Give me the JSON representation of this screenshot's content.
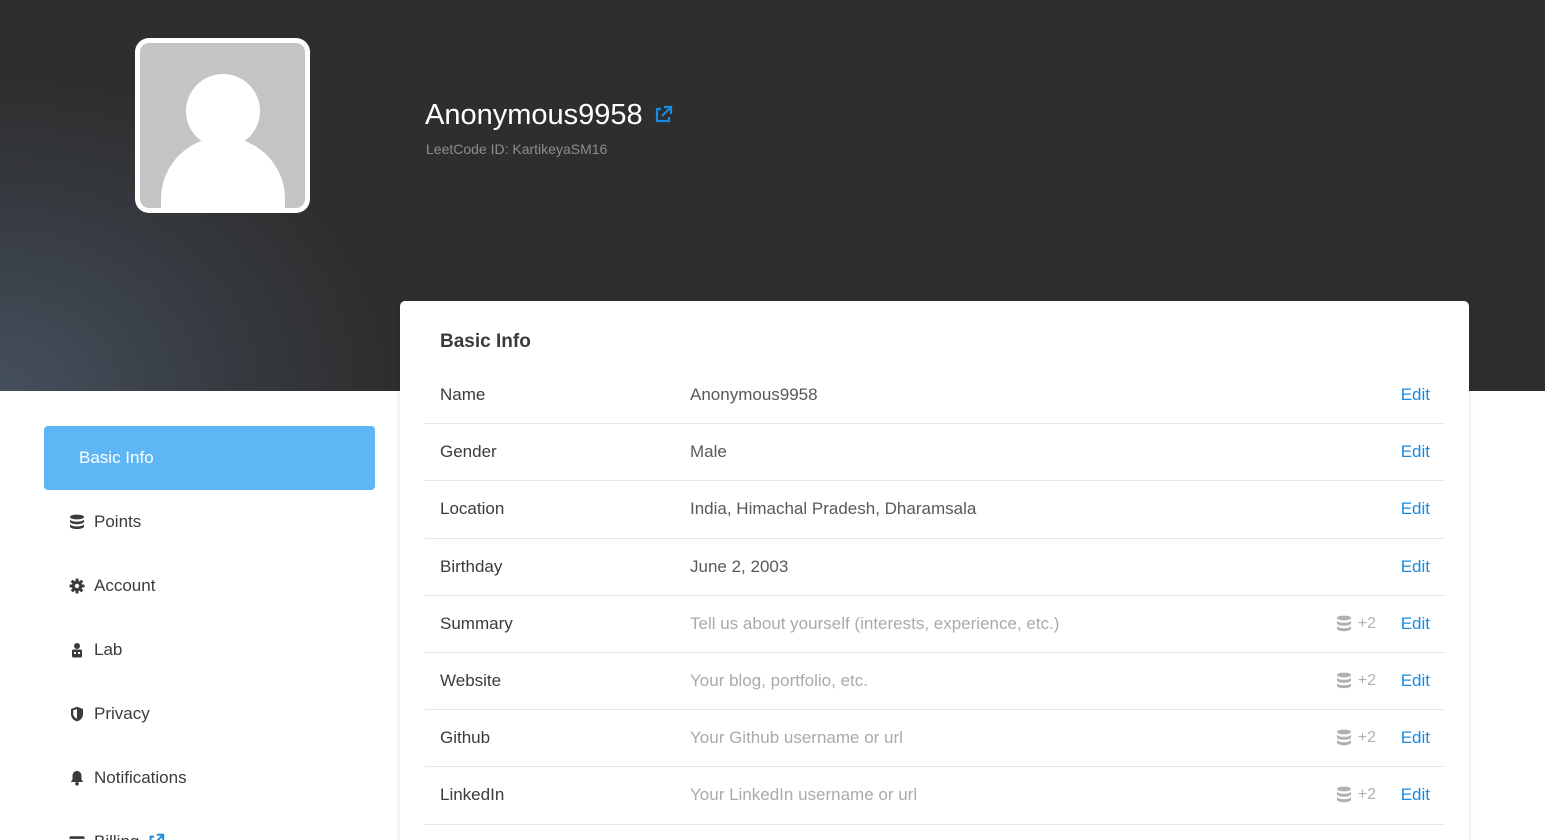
{
  "profile": {
    "username": "Anonymous9958",
    "leetcode_id": "LeetCode ID: KartikeyaSM16"
  },
  "sidebar": {
    "items": [
      {
        "label": "Basic Info",
        "icon": "none",
        "active": true
      },
      {
        "label": "Points",
        "icon": "database-icon"
      },
      {
        "label": "Account",
        "icon": "gear-icon"
      },
      {
        "label": "Lab",
        "icon": "lab-icon"
      },
      {
        "label": "Privacy",
        "icon": "shield-icon"
      },
      {
        "label": "Notifications",
        "icon": "bell-icon"
      },
      {
        "label": "Billing",
        "icon": "credit-card-icon"
      }
    ]
  },
  "basic_info": {
    "title": "Basic Info",
    "edit_label": "Edit",
    "rows": [
      {
        "label": "Name",
        "value": "Anonymous9958"
      },
      {
        "label": "Gender",
        "value": "Male"
      },
      {
        "label": "Location",
        "value": "India, Himachal Pradesh, Dharamsala"
      },
      {
        "label": "Birthday",
        "value": "June 2, 2003"
      },
      {
        "label": "Summary",
        "placeholder": "Tell us about yourself (interests, experience, etc.)",
        "points": "+2"
      },
      {
        "label": "Website",
        "placeholder": "Your blog, portfolio, etc.",
        "points": "+2"
      },
      {
        "label": "Github",
        "placeholder": "Your Github username or url",
        "points": "+2"
      },
      {
        "label": "LinkedIn",
        "placeholder": "Your LinkedIn username or url",
        "points": "+2"
      }
    ]
  },
  "colors": {
    "accent": "#1a8ae0",
    "active_nav": "#5fb6f5",
    "hero_bg": "#2e2e2e"
  }
}
